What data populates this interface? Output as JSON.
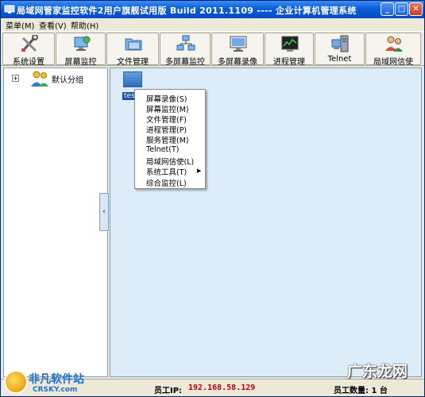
{
  "window": {
    "title": "局域网管家监控软件2用户旗舰试用版   Build 2011.1109   ----   企业计算机管理系统",
    "min_label": "_",
    "max_label": "□",
    "close_label": "✕"
  },
  "menubar": {
    "items": [
      {
        "label": "菜单(M)"
      },
      {
        "label": "查看(V)"
      },
      {
        "label": "帮助(H)"
      }
    ]
  },
  "toolbar": {
    "buttons": [
      {
        "label": "系统设置",
        "icon": "tools-icon"
      },
      {
        "label": "屏幕监控",
        "icon": "screen-monitor-icon"
      },
      {
        "label": "文件管理",
        "icon": "folder-icon"
      },
      {
        "label": "多屏幕监控",
        "icon": "network-icon"
      },
      {
        "label": "多屏幕录像",
        "icon": "monitor-icon"
      },
      {
        "label": "进程管理",
        "icon": "process-icon"
      },
      {
        "label": "Telnet",
        "icon": "server-icon"
      },
      {
        "label": "局域网信使",
        "icon": "users-icon"
      }
    ]
  },
  "tree": {
    "expander": "+",
    "root_label": "默认分组"
  },
  "collapse_handle": {
    "label": "‹"
  },
  "content": {
    "device_label": "tes"
  },
  "context_menu": {
    "items": [
      {
        "label": "屏幕录像(S)"
      },
      {
        "label": "屏幕监控(M)"
      },
      {
        "label": "文件管理(F)"
      },
      {
        "label": "进程管理(P)"
      },
      {
        "label": "服务管理(M)"
      },
      {
        "label": "Telnet(T)"
      },
      {
        "label": "局域网信使(L)"
      },
      {
        "label": "系统工具(T)",
        "submenu_arrow": "▶"
      },
      {
        "label": "综合监控(L)"
      }
    ]
  },
  "statusbar": {
    "ip_label": "员工IP:",
    "ip_value": "192.168.58.129",
    "count_text": "员工数量:  1  台"
  },
  "watermarks": {
    "left_title": "非凡软件站",
    "left_sub": "CRSKY.com",
    "right_text": "广东龙网"
  },
  "colors": {
    "titlebar": "#0548c4",
    "content_bg": "#dcecf8",
    "ip_value": "#c00000"
  }
}
